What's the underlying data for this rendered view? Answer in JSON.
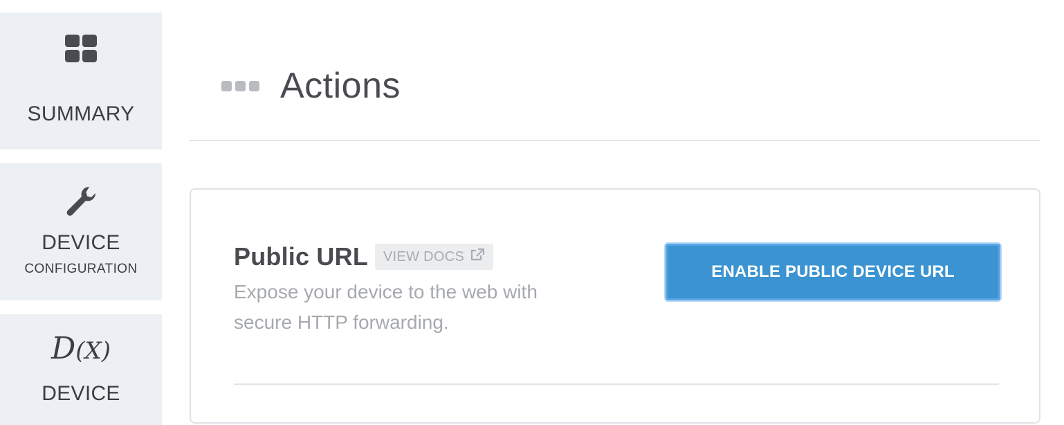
{
  "sidebar": {
    "items": [
      {
        "label": "SUMMARY",
        "icon": "dashboard-grid-icon"
      },
      {
        "label": "DEVICE",
        "sublabel": "CONFIGURATION",
        "icon": "wrench-icon"
      },
      {
        "label": "DEVICE",
        "icon": "dx-function-icon",
        "icon_text": "D",
        "icon_subtext": "(X)"
      }
    ]
  },
  "header": {
    "title": "Actions",
    "icon": "more-dots-icon"
  },
  "card": {
    "section_title": "Public URL",
    "docs_label": "VIEW DOCS",
    "docs_icon": "external-link-icon",
    "description": "Expose your device to the web with secure HTTP forwarding.",
    "button_label": "ENABLE PUBLIC DEVICE URL"
  },
  "colors": {
    "sidebar_bg": "#eceff3",
    "primary_button": "#3b94d1",
    "text_dark": "#4a4a4f",
    "text_muted": "#a6a9ae"
  }
}
